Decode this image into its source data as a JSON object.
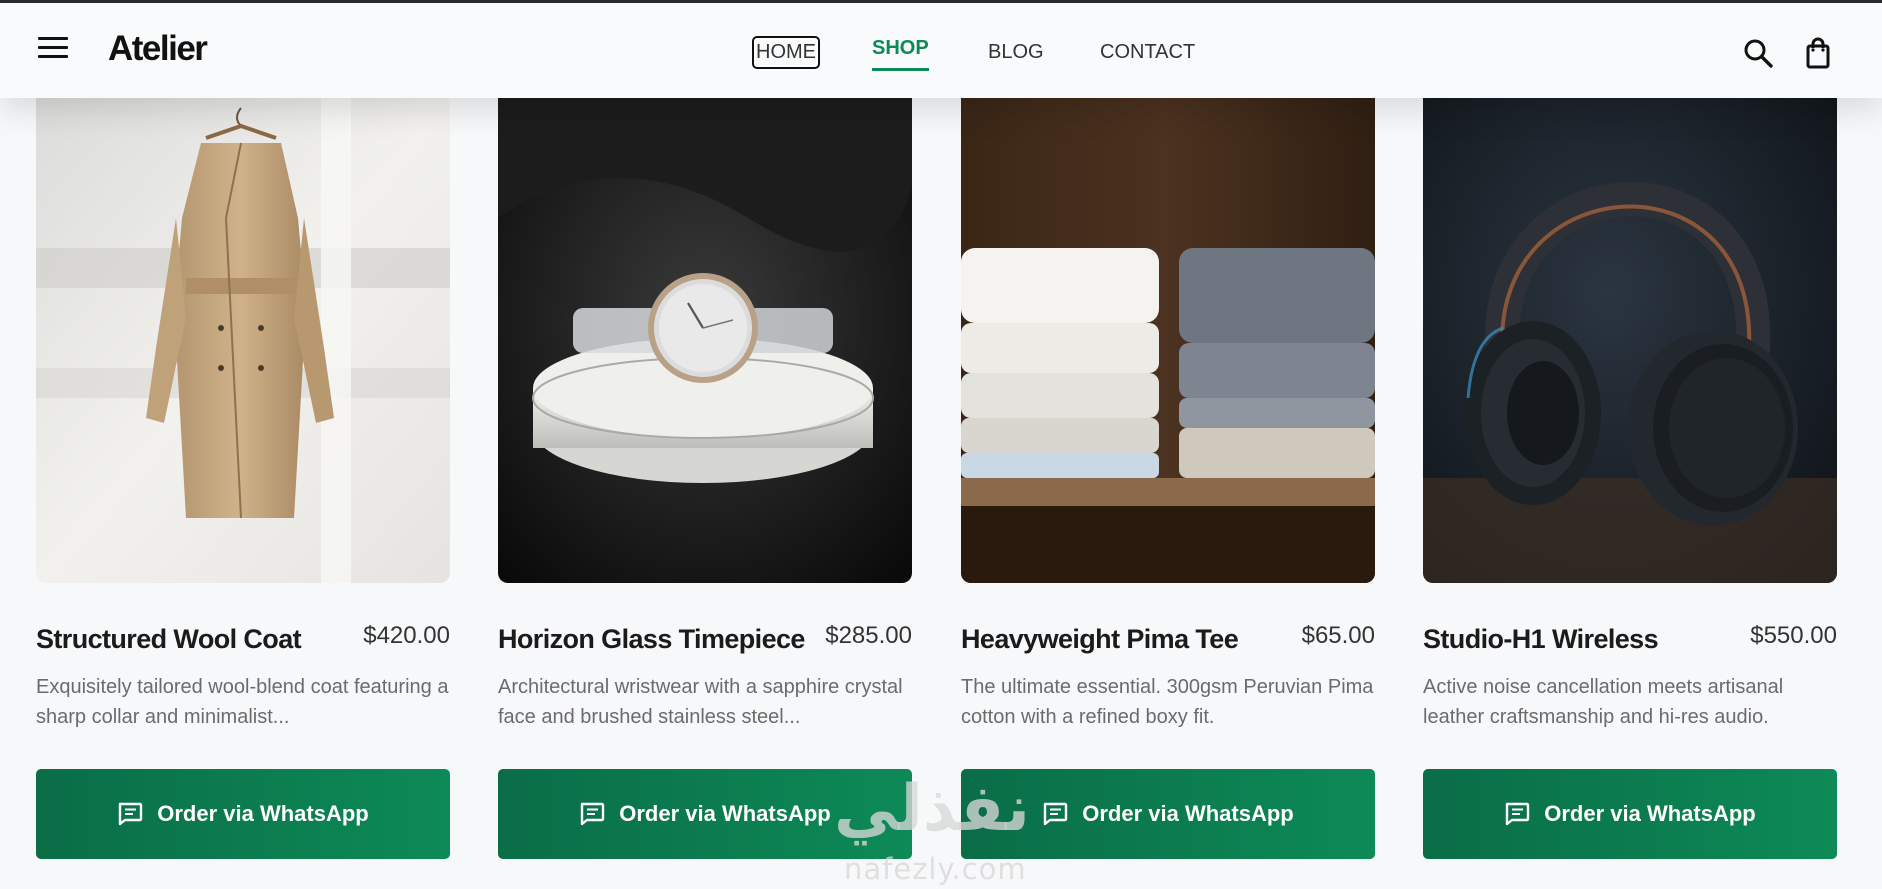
{
  "brand": {
    "name": "Atelier"
  },
  "nav": {
    "home": "HOME",
    "shop": "SHOP",
    "blog": "BLOG",
    "contact": "CONTACT",
    "active": "SHOP",
    "accent_color": "#0a8a55"
  },
  "header_icons": [
    "menu-icon",
    "search-icon",
    "shopping-bag-icon"
  ],
  "products": [
    {
      "title": "Structured Wool Coat",
      "price": "$420.00",
      "description": "Exquisitely tailored wool-blend coat featuring a sharp collar and minimalist...",
      "button": "Order via WhatsApp"
    },
    {
      "title": "Horizon Glass Timepiece",
      "price": "$285.00",
      "description": "Architectural wristwear with a sapphire crystal face and brushed stainless steel...",
      "button": "Order via WhatsApp"
    },
    {
      "title": "Heavyweight Pima Tee",
      "price": "$65.00",
      "description": "The ultimate essential. 300gsm Peruvian Pima cotton with a refined boxy fit.",
      "button": "Order via WhatsApp"
    },
    {
      "title": "Studio-H1 Wireless",
      "price": "$550.00",
      "description": "Active noise cancellation meets artisanal leather craftsmanship and hi-res audio.",
      "button": "Order via WhatsApp"
    }
  ],
  "button_color": "#0b7a4e",
  "watermark": {
    "arabic": "نفذلي",
    "latin": "nafezly.com"
  }
}
